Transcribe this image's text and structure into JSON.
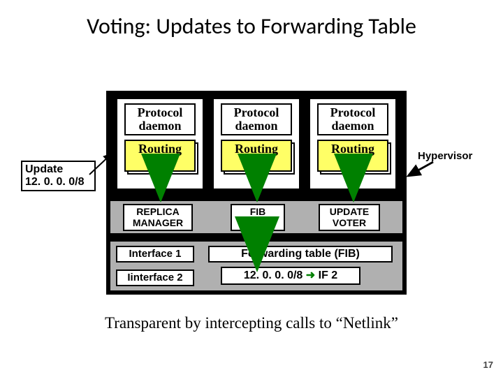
{
  "title": "Voting: Updates to Forwarding Table",
  "update": {
    "line1": "Update",
    "line2": "12. 0. 0. 0/8"
  },
  "replicas": {
    "proto": "Protocol daemon",
    "rt": "Routing table"
  },
  "mid": {
    "replica_manager": "REPLICA MANAGER",
    "fib_voter": "FIB VOTER",
    "update_voter": "UPDATE VOTER"
  },
  "low": {
    "if1": "Interface 1",
    "if2": "Iinterface 2",
    "fib": "Forwarding table (FIB)",
    "route_prefix": "12. 0. 0. 0/8 ",
    "route_arrow": "➜",
    "route_suffix": " IF 2"
  },
  "hypervisor": "Hypervisor",
  "caption": "Transparent by intercepting calls to “Netlink”",
  "page": "17"
}
